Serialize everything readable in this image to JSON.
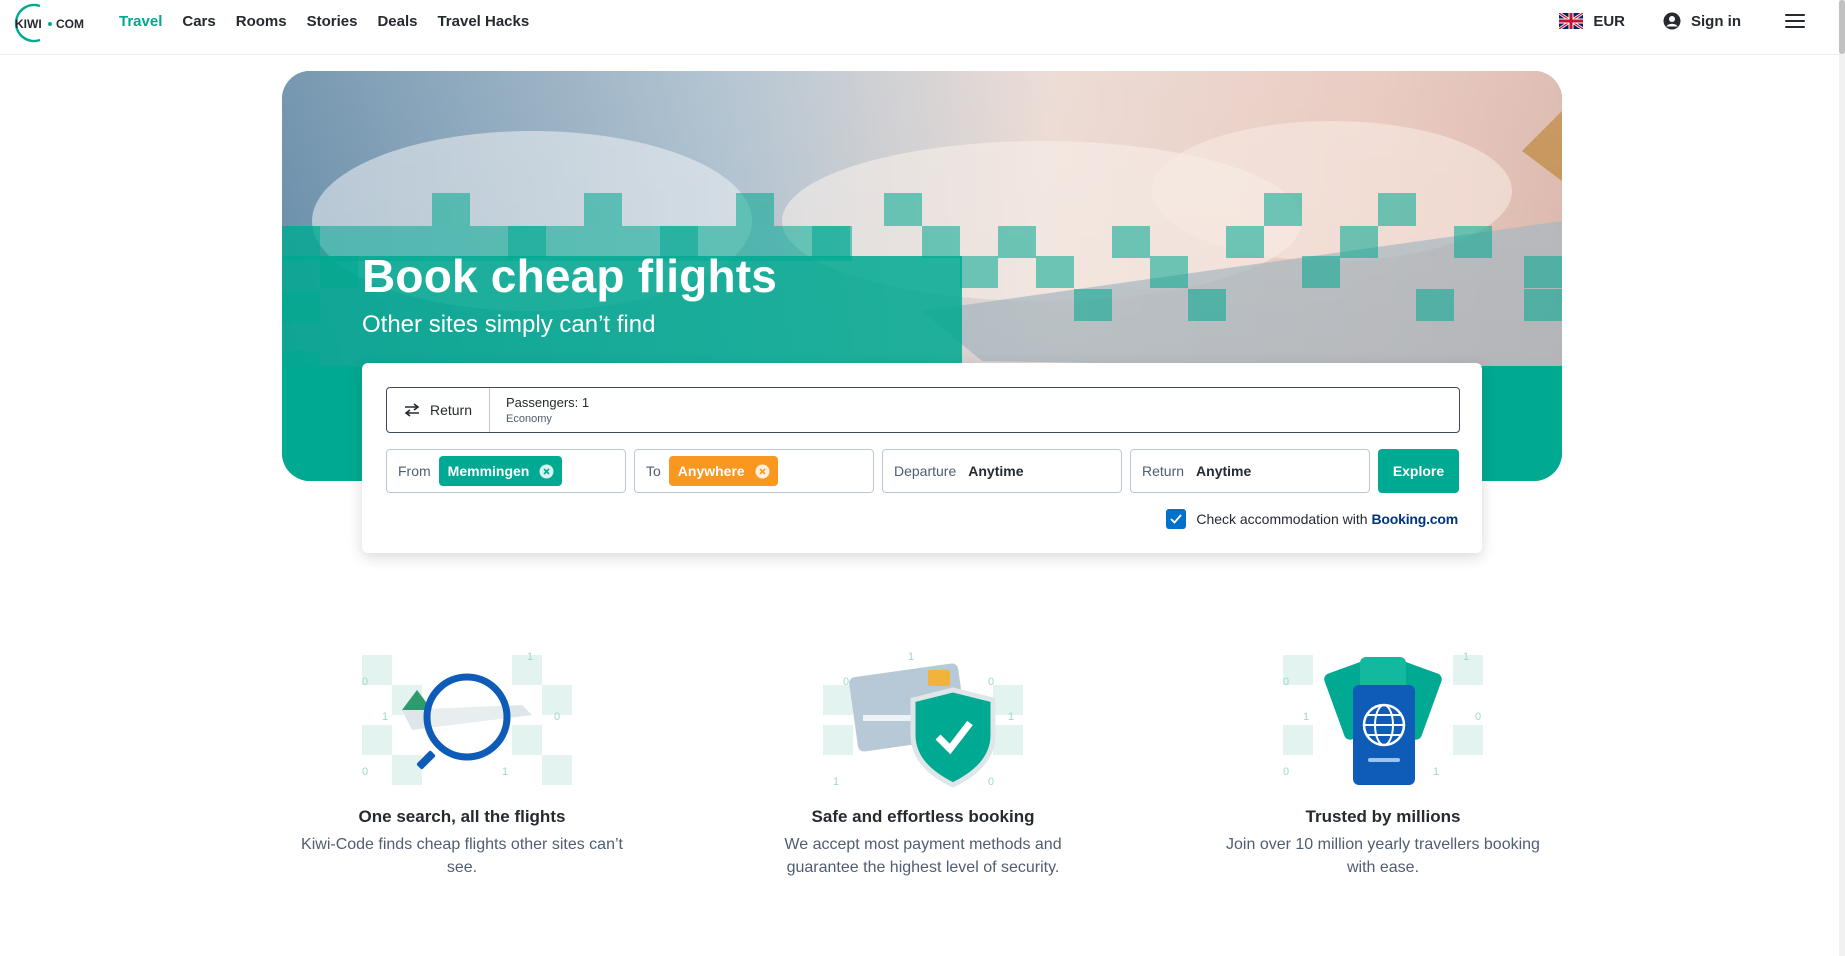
{
  "brand": {
    "logo_text": "KIWI·COM",
    "accent": "#00a991",
    "orange": "#f9971e",
    "checkbox": "#0172cb",
    "booking_blue": "#003580"
  },
  "nav": {
    "items": [
      {
        "label": "Travel",
        "active": true
      },
      {
        "label": "Cars",
        "active": false
      },
      {
        "label": "Rooms",
        "active": false
      },
      {
        "label": "Stories",
        "active": false
      },
      {
        "label": "Deals",
        "active": false
      },
      {
        "label": "Travel Hacks",
        "active": false
      }
    ]
  },
  "header": {
    "currency": "EUR",
    "flag_icon": "uk-flag-icon",
    "sign_in": "Sign in",
    "menu_icon": "hamburger-menu-icon"
  },
  "hero": {
    "title": "Book cheap flights",
    "subtitle": "Other sites simply can’t find"
  },
  "search": {
    "trip_type": "Return",
    "passengers": "Passengers: 1",
    "cabin": "Economy",
    "from_label": "From",
    "from_value": "Memmingen",
    "to_label": "To",
    "to_value": "Anywhere",
    "departure_label": "Departure",
    "departure_value": "Anytime",
    "return_label": "Return",
    "return_value": "Anytime",
    "explore": "Explore",
    "accommodation_text": "Check accommodation with",
    "accommodation_brand": "Booking.com",
    "accommodation_checked": true
  },
  "features": [
    {
      "icon": "plane-magnifier-icon",
      "title": "One search, all the flights",
      "text": "Kiwi-Code finds cheap flights other sites can’t see."
    },
    {
      "icon": "card-shield-icon",
      "title": "Safe and effortless booking",
      "text": "We accept most payment methods and guarantee the highest level of security."
    },
    {
      "icon": "passport-tickets-icon",
      "title": "Trusted by millions",
      "text": "Join over 10 million yearly travellers booking with ease."
    }
  ]
}
